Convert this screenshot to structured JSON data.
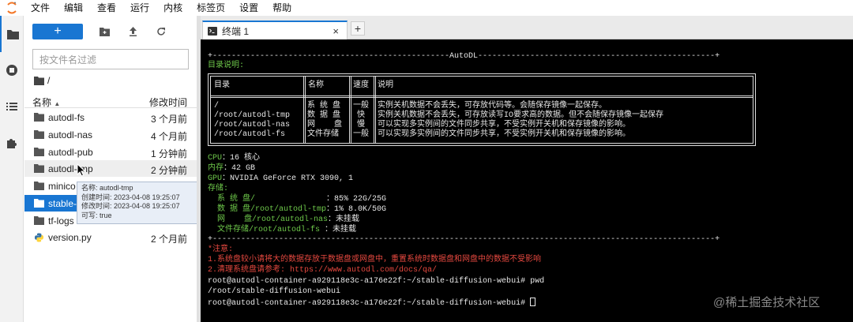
{
  "menubar": {
    "items": [
      "文件",
      "编辑",
      "查看",
      "运行",
      "内核",
      "标签页",
      "设置",
      "帮助"
    ]
  },
  "sidebar": {
    "filter_placeholder": "按文件名过滤",
    "breadcrumb": "/",
    "columns": {
      "name": "名称",
      "modified": "修改时间"
    },
    "files": [
      {
        "name": "autodl-fs",
        "modified": "3 个月前",
        "type": "folder"
      },
      {
        "name": "autodl-nas",
        "modified": "4 个月前",
        "type": "folder"
      },
      {
        "name": "autodl-pub",
        "modified": "1 分钟前",
        "type": "folder"
      },
      {
        "name": "autodl-tmp",
        "modified": "2 分钟前",
        "type": "folder"
      },
      {
        "name": "minico",
        "modified": "",
        "type": "folder"
      },
      {
        "name": "stable-",
        "modified": "",
        "type": "folder"
      },
      {
        "name": "tf-logs",
        "modified": "",
        "type": "folder"
      },
      {
        "name": "version.py",
        "modified": "2 个月前",
        "type": "python"
      }
    ],
    "tooltip": {
      "name": "名称: autodl-tmp",
      "created": "创建时间: 2023-04-08 19:25:07",
      "modified": "修改时间: 2023-04-08 19:25:07",
      "writable": "可写: true"
    }
  },
  "tab": {
    "label": "终端 1",
    "close": "×",
    "add": "+"
  },
  "terminal": {
    "banner": "+--------------------------------------------------AutoDL--------------------------------------------------+",
    "dir_title": "目录说明:",
    "table": {
      "headers": [
        "目录",
        "名称",
        "速度",
        "说明"
      ],
      "paths": [
        "/",
        "/root/autodl-tmp",
        "/root/autodl-nas",
        "/root/autodl-fs"
      ],
      "names": [
        "系 统 盘",
        "数 据 盘",
        "网    盘",
        "文件存储"
      ],
      "speeds": [
        "一般",
        "快",
        "慢",
        "一般"
      ],
      "descs": [
        "实例关机数据不会丢失，可存放代码等。会随保存镜像一起保存。",
        "实例关机数据不会丢失，可存放读写IO要求高的数据。但不会随保存镜像一起保存",
        "可以实现多实例间的文件同步共享，不受实例开关机和保存镜像的影响。",
        "可以实现多实例间的文件同步共享，不受实例开关机和保存镜像的影响。"
      ]
    },
    "cpu_label": "CPU",
    "cpu_value": "：16 核心",
    "mem_label": "内存",
    "mem_value": "：42 GB",
    "gpu_label": "GPU",
    "gpu_value": "：NVIDIA GeForce RTX 3090, 1",
    "storage_label": "存储:",
    "storage": [
      {
        "label": "  系 统 盘/               ",
        "value": "：85% 22G/25G"
      },
      {
        "label": "  数 据 盘/root/autodl-tmp",
        "value": "：1% 8.0K/50G"
      },
      {
        "label": "  网    盘/root/autodl-nas",
        "value": "：未挂载"
      },
      {
        "label": "  文件存储/root/autodl-fs ",
        "value": "：未挂载"
      }
    ],
    "banner_end": "+----------------------------------------------------------------------------------------------------------+",
    "notice_title": "*注意:",
    "notice_1": "1.系统盘较小请将大的数据存放于数据盘或网盘中，重置系统时数据盘和网盘中的数据不受影响",
    "notice_2": "2.清理系统盘请参考: https://www.autodl.com/docs/qa/",
    "cmd_1": "root@autodl-container-a929118e3c-a176e22f:~/stable-diffusion-webui# pwd",
    "out_1": "/root/stable-diffusion-webui",
    "cmd_2": "root@autodl-container-a929118e3c-a176e22f:~/stable-diffusion-webui# "
  },
  "watermark": "@稀土掘金技术社区",
  "colors": {
    "accent": "#1976d2",
    "term_green": "#6ec84a",
    "term_red": "#e5483f"
  }
}
